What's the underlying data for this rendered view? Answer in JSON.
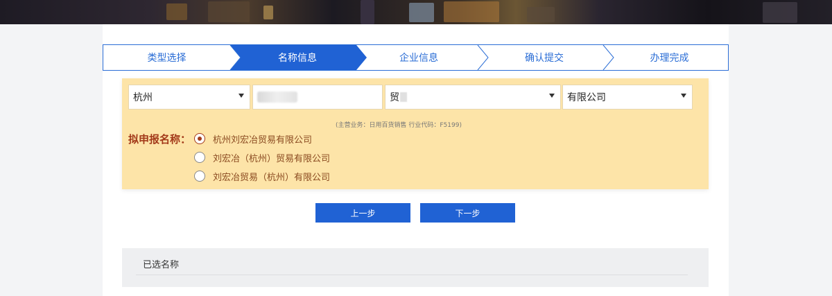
{
  "steps": [
    {
      "label": "类型选择",
      "active": false
    },
    {
      "label": "名称信息",
      "active": true
    },
    {
      "label": "企业信息",
      "active": false
    },
    {
      "label": "确认提交",
      "active": false
    },
    {
      "label": "办理完成",
      "active": false
    }
  ],
  "form": {
    "region": "杭州",
    "trade_prefix": "贸",
    "org_form": "有限公司",
    "hint": "(主营业务：日用百货销售    行业代码：F5199)"
  },
  "proposed": {
    "label": "拟申报名称：",
    "options": [
      {
        "text": "杭州刘宏冶贸易有限公司",
        "checked": true
      },
      {
        "text": "刘宏冶（杭州）贸易有限公司",
        "checked": false
      },
      {
        "text": "刘宏冶贸易（杭州）有限公司",
        "checked": false
      }
    ]
  },
  "buttons": {
    "prev": "上一步",
    "next": "下一步"
  },
  "selected": {
    "title": "已选名称"
  },
  "colors": {
    "accent": "#2062d4",
    "panel": "#fde4a8",
    "label": "#a33a1a"
  }
}
